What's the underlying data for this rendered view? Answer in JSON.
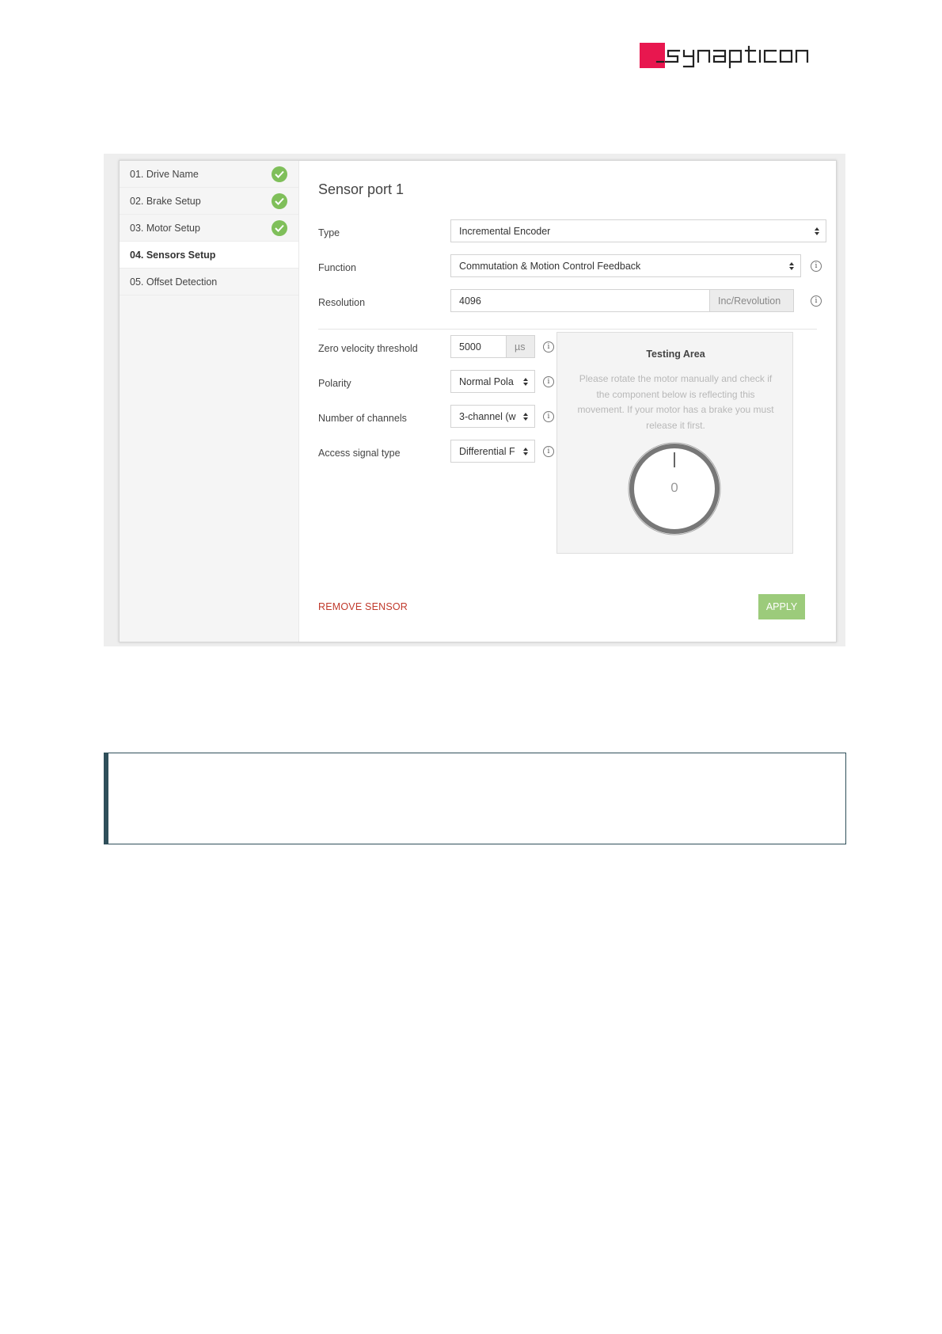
{
  "logo": {
    "text": "synapticon",
    "brand_color": "#e8174f"
  },
  "wizard": {
    "steps": [
      {
        "label": "01. Drive Name",
        "done": true
      },
      {
        "label": "02. Brake Setup",
        "done": true
      },
      {
        "label": "03. Motor Setup",
        "done": true
      },
      {
        "label": "04. Sensors Setup",
        "done": false,
        "active": true
      },
      {
        "label": "05. Offset Detection",
        "done": false
      }
    ]
  },
  "sensor": {
    "title": "Sensor port 1",
    "type_label": "Type",
    "type_value": "Incremental Encoder",
    "function_label": "Function",
    "function_value": "Commutation & Motion Control Feedback",
    "resolution_label": "Resolution",
    "resolution_value": "4096",
    "resolution_unit": "Inc/Revolution",
    "zero_velocity_label": "Zero velocity threshold",
    "zero_velocity_value": "5000",
    "zero_velocity_unit": "µs",
    "polarity_label": "Polarity",
    "polarity_value": "Normal Pola",
    "channels_label": "Number of channels",
    "channels_value": "3-channel (w",
    "access_label": "Access signal type",
    "access_value": "Differential F"
  },
  "testing": {
    "title": "Testing Area",
    "text": "Please rotate the motor manually and check if the component below is reflecting this movement. If your motor has a brake you must release it first.",
    "dial_value": "0"
  },
  "actions": {
    "remove": "REMOVE SENSOR",
    "apply": "APPLY"
  },
  "colors": {
    "success": "#7fbf5a",
    "danger": "#c0392b",
    "apply": "#9ccb7b"
  }
}
